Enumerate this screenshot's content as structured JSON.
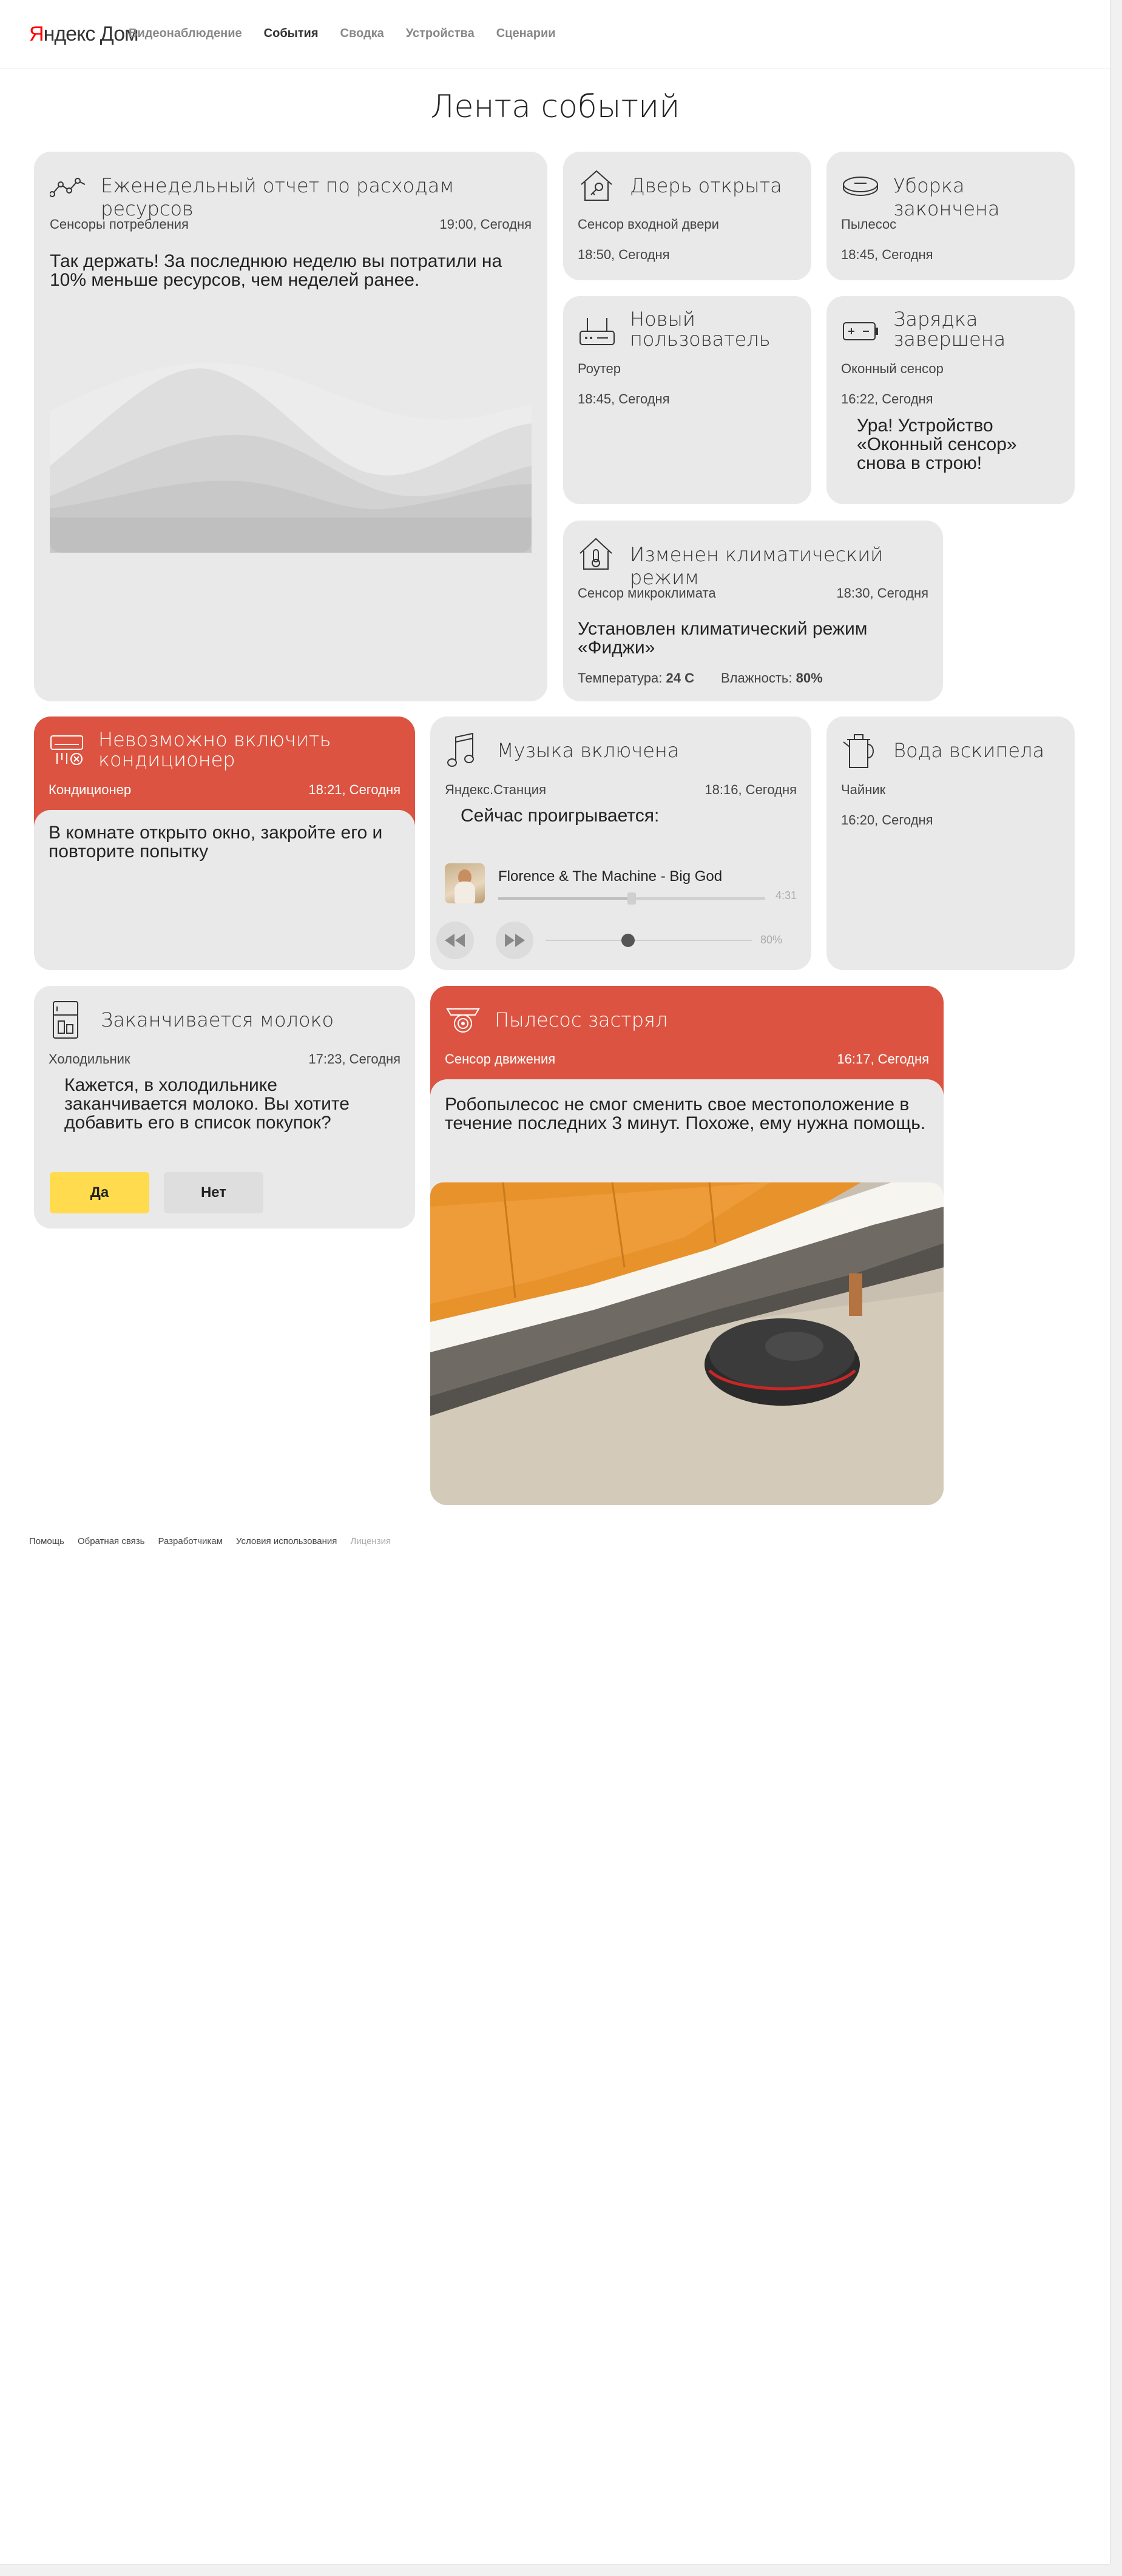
{
  "brand": {
    "logo_y": "Я",
    "logo_rest": "ндекс Дом"
  },
  "nav": [
    "Видеонаблюдение",
    "События",
    "Сводка",
    "Устройства",
    "Сценарии"
  ],
  "page_title": "Лента событий",
  "weekly": {
    "title": "Еженедельный отчет по расходам ресурсов",
    "source": "Сенсоры потребления",
    "time": "19:00, Сегодня",
    "text": "Так держать! За последнюю неделю вы потратили на 10% меньше ресурсов, чем неделей ранее."
  },
  "door": {
    "title": "Дверь открыта",
    "source": "Сенсор входной двери",
    "time": "18:50, Сегодня"
  },
  "cleaning": {
    "title": "Уборка закончена",
    "source": "Пылесос",
    "time": "18:45, Сегодня"
  },
  "newuser": {
    "title_1": "Новый",
    "title_2": "пользователь",
    "source": "Роутер",
    "time": "18:45, Сегодня"
  },
  "charge": {
    "title_1": "Зарядка",
    "title_2": "завершена",
    "source": "Оконный сенсор",
    "time": "16:22, Сегодня",
    "text": "Ура! Устройство «Оконный сенсор» снова в строю!"
  },
  "climate": {
    "title": "Изменен климатический режим",
    "source": "Сенсор микроклимата",
    "time": "18:30, Сегодня",
    "text": "Установлен климатический режим «Фиджи»",
    "temp_label": "Температура:",
    "temp_value": "24 С",
    "hum_label": "Влажность:",
    "hum_value": "80%"
  },
  "ac": {
    "title": "Невозможно включить кондиционер",
    "source": "Кондиционер",
    "time": "18:21, Сегодня",
    "text": "В комнате открыто окно, закройте его и повторите попытку"
  },
  "music": {
    "title": "Музыка включена",
    "source": "Яндекс.Станция",
    "time": "18:16, Сегодня",
    "now_playing": "Сейчас проигрывается:",
    "track": "Florence & The Machine - Big God",
    "duration": "4:31",
    "progress": 0.5,
    "volume_label": "80%",
    "volume": 0.4
  },
  "kettle": {
    "title": "Вода вскипела",
    "source": "Чайник",
    "time": "16:20, Сегодня"
  },
  "milk": {
    "title": "Заканчивается молоко",
    "source": "Холодильник",
    "time": "17:23, Сегодня",
    "text": "Кажется, в холодильнике заканчивается молоко. Вы хотите добавить его в список покупок?",
    "yes": "Да",
    "no": "Нет"
  },
  "vacuum": {
    "title": "Пылесос застрял",
    "source": "Сенсор движения",
    "time": "16:17, Сегодня",
    "text": "Робопылесос не смог сменить свое местоположение в течение последних 3 минут. Похоже, ему нужна помощь."
  },
  "footer": [
    "Помощь",
    "Обратная связь",
    "Разработчикам",
    "Условия использования",
    "Лицензия"
  ],
  "colors": {
    "accent_red": "#dc5441",
    "button_yellow": "#ffdb4d",
    "card_bg": "#e9e9e9"
  }
}
